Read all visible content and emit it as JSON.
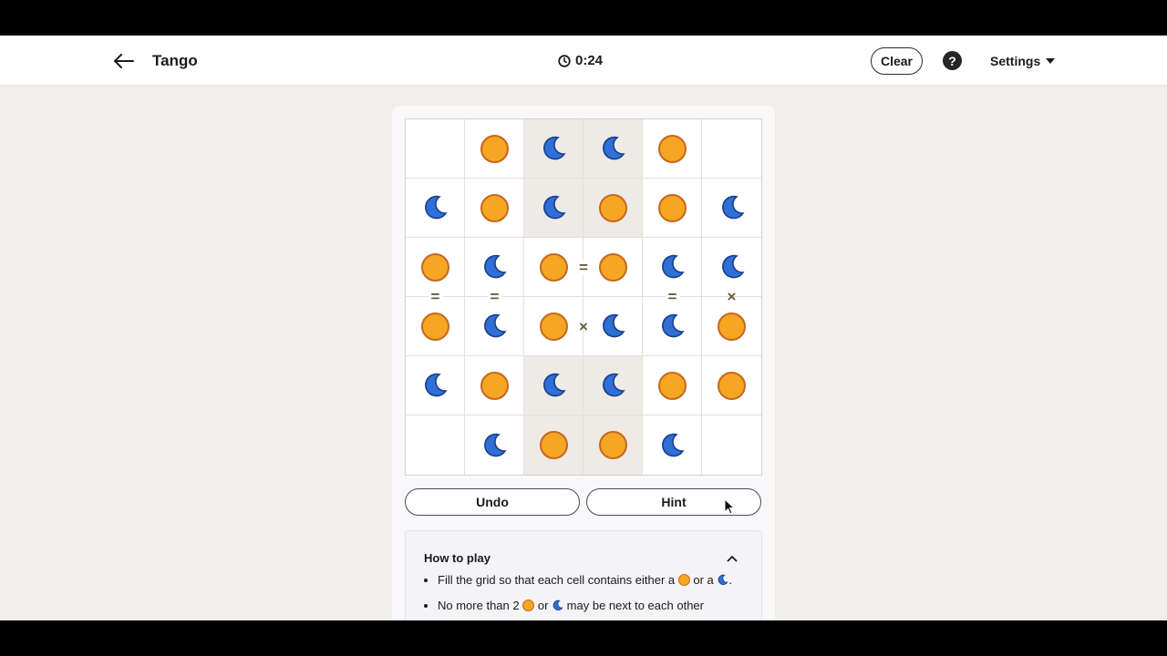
{
  "header": {
    "back_icon": "arrow-left-icon",
    "title": "Tango",
    "timer_icon": "clock-icon",
    "timer": "0:24",
    "clear_label": "Clear",
    "help_label": "?",
    "settings_label": "Settings"
  },
  "board": {
    "rows": 6,
    "cols": 6,
    "cells": [
      [
        "",
        "sun",
        "moon",
        "moon",
        "sun",
        ""
      ],
      [
        "moon",
        "sun",
        "moon",
        "sun",
        "sun",
        "moon"
      ],
      [
        "sun",
        "moon",
        "sun",
        "sun",
        "moon",
        "moon"
      ],
      [
        "sun",
        "moon",
        "sun",
        "moon",
        "moon",
        "sun"
      ],
      [
        "moon",
        "sun",
        "moon",
        "moon",
        "sun",
        "sun"
      ],
      [
        "",
        "moon",
        "sun",
        "sun",
        "moon",
        ""
      ]
    ],
    "locked": [
      [
        false,
        false,
        true,
        true,
        false,
        false
      ],
      [
        false,
        false,
        true,
        true,
        false,
        false
      ],
      [
        false,
        false,
        false,
        false,
        false,
        false
      ],
      [
        false,
        false,
        false,
        false,
        false,
        false
      ],
      [
        false,
        false,
        true,
        true,
        false,
        false
      ],
      [
        false,
        false,
        true,
        true,
        false,
        false
      ]
    ],
    "constraints": [
      {
        "symbol": "=",
        "kind": "eq",
        "from": [
          2,
          2
        ],
        "to": [
          2,
          3
        ]
      },
      {
        "symbol": "=",
        "kind": "eq",
        "from": [
          2,
          0
        ],
        "to": [
          3,
          0
        ]
      },
      {
        "symbol": "=",
        "kind": "eq",
        "from": [
          2,
          1
        ],
        "to": [
          3,
          1
        ]
      },
      {
        "symbol": "=",
        "kind": "eq",
        "from": [
          2,
          4
        ],
        "to": [
          3,
          4
        ]
      },
      {
        "symbol": "×",
        "kind": "x",
        "from": [
          2,
          5
        ],
        "to": [
          3,
          5
        ]
      },
      {
        "symbol": "×",
        "kind": "x",
        "from": [
          3,
          2
        ],
        "to": [
          3,
          3
        ]
      }
    ]
  },
  "controls": {
    "undo_label": "Undo",
    "hint_label": "Hint"
  },
  "howto": {
    "title": "How to play",
    "rule1_a": "Fill the grid so that each cell contains either a",
    "rule1_b": "or a",
    "rule1_c": ".",
    "rule2_a": "No more than 2",
    "rule2_b": "or",
    "rule2_c": "may be next to each other"
  },
  "colors": {
    "sun_fill": "#f5a623",
    "sun_stroke": "#c8671e",
    "moon_fill": "#2f6fd6",
    "moon_stroke": "#173f8a",
    "locked_bg": "#eeeae6"
  }
}
